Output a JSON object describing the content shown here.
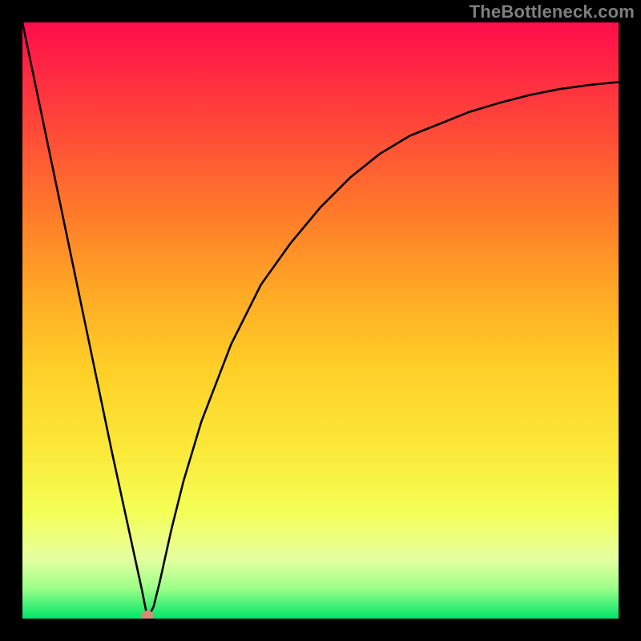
{
  "watermark": "TheBottleneck.com",
  "chart_data": {
    "type": "line",
    "title": "",
    "xlabel": "",
    "ylabel": "",
    "xlim": [
      0,
      100
    ],
    "ylim": [
      0,
      100
    ],
    "grid": false,
    "legend": false,
    "series": [
      {
        "name": "curve",
        "x": [
          0,
          5,
          10,
          15,
          20,
          21,
          22,
          23,
          25,
          27,
          30,
          35,
          40,
          45,
          50,
          55,
          60,
          65,
          70,
          75,
          80,
          85,
          90,
          95,
          100
        ],
        "y": [
          100,
          76,
          52,
          28,
          5,
          0,
          2,
          6,
          15,
          23,
          33,
          46,
          56,
          63,
          69,
          74,
          78,
          81,
          83,
          85,
          86.5,
          87.8,
          88.8,
          89.5,
          90
        ]
      }
    ],
    "marker": {
      "x": 21,
      "y": 0.6,
      "color": "#d98b7a"
    },
    "background_gradient": {
      "stops": [
        {
          "pos": 0.0,
          "color": "#ff0d4c"
        },
        {
          "pos": 0.15,
          "color": "#ff3f3b"
        },
        {
          "pos": 0.32,
          "color": "#ff7a2a"
        },
        {
          "pos": 0.45,
          "color": "#ffa825"
        },
        {
          "pos": 0.58,
          "color": "#ffcf27"
        },
        {
          "pos": 0.72,
          "color": "#fbe93a"
        },
        {
          "pos": 0.82,
          "color": "#f4ff55"
        },
        {
          "pos": 0.9,
          "color": "#e6ffa0"
        },
        {
          "pos": 0.95,
          "color": "#9aff88"
        },
        {
          "pos": 1.0,
          "color": "#00e56a"
        }
      ]
    }
  }
}
